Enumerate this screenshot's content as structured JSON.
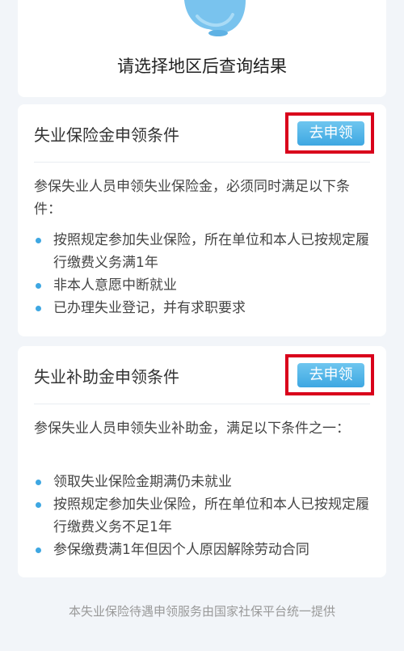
{
  "header": {
    "prompt": "请选择地区后查询结果"
  },
  "cards": [
    {
      "title": "失业保险金申领条件",
      "apply_label": "去申领",
      "intro": "参保失业人员申领失业保险金，必须同时满足以下条件：",
      "conditions": [
        "按照规定参加失业保险，所在单位和本人已按规定履行缴费义务满1年",
        "非本人意愿中断就业",
        "已办理失业登记，并有求职要求"
      ]
    },
    {
      "title": "失业补助金申领条件",
      "apply_label": "去申领",
      "intro": "参保失业人员申领失业补助金，满足以下条件之一：",
      "conditions": [
        "领取失业保险金期满仍未就业",
        "按照规定参加失业保险，所在单位和本人已按规定履行缴费义务不足1年",
        "参保缴费满1年但因个人原因解除劳动合同"
      ]
    }
  ],
  "footer": {
    "text": "本失业保险待遇申领服务由国家社保平台统一提供"
  },
  "colors": {
    "accent": "#3ea7e2",
    "highlight_frame": "#d9001b",
    "background": "#f2f5f9"
  },
  "icons": {
    "mascot": "mascot-illustration"
  }
}
